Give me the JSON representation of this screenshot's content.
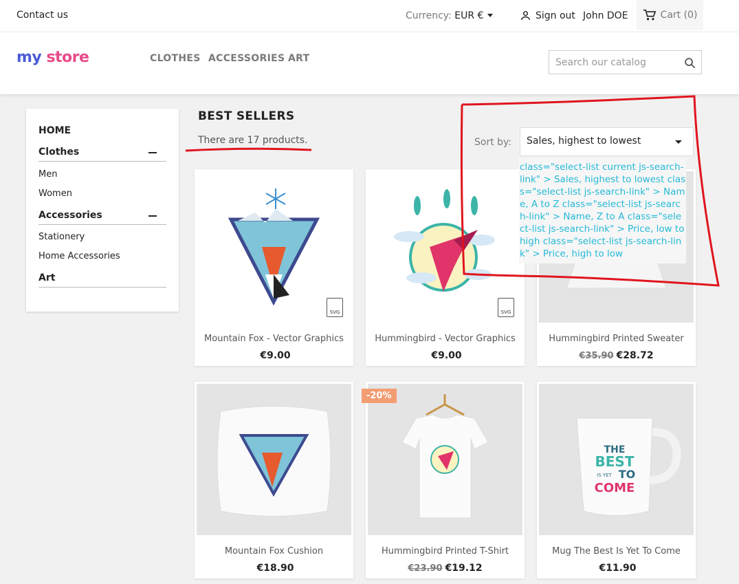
{
  "topbar": {
    "contact": "Contact us",
    "currency_label": "Currency:",
    "currency_value": "EUR €",
    "signout": "Sign out",
    "username": "John DOE",
    "cart": "Cart (0)"
  },
  "header": {
    "logo_part1": "my",
    "logo_part2": "store",
    "nav": [
      "CLOTHES",
      "ACCESSORIES",
      "ART"
    ],
    "search_placeholder": "Search our catalog"
  },
  "sidebar": {
    "home": "HOME",
    "categories": [
      {
        "label": "Clothes",
        "children": [
          "Men",
          "Women"
        ]
      },
      {
        "label": "Accessories",
        "children": [
          "Stationery",
          "Home Accessories"
        ]
      },
      {
        "label": "Art",
        "children": []
      }
    ]
  },
  "main": {
    "title": "BEST SELLERS",
    "count": "There are 17 products.",
    "sort_label": "Sort by:",
    "sort_value": "Sales, highest to lowest",
    "dropdown_text": "class=\"select-list current js-search-link\" > Sales, highest to lowest class=\"select-list js-search-link\" > Name, A to Z class=\"select-list js-search-link\" > Name, Z to A class=\"select-list js-search-link\" > Price, low to high class=\"select-list js-search-link\" > Price, high to low"
  },
  "products": [
    {
      "name": "Mountain Fox - Vector Graphics",
      "price": "€9.00",
      "old_price": ""
    },
    {
      "name": "Hummingbird - Vector Graphics",
      "price": "€9.00",
      "old_price": ""
    },
    {
      "name": "Hummingbird Printed Sweater",
      "price": "€28.72",
      "old_price": "€35.90"
    },
    {
      "name": "Mountain Fox Cushion",
      "price": "€18.90",
      "old_price": ""
    },
    {
      "name": "Hummingbird Printed T-Shirt",
      "price": "€19.12",
      "old_price": "€23.90",
      "badge": "-20%"
    },
    {
      "name": "Mug The Best Is Yet To Come",
      "price": "€11.90",
      "old_price": ""
    }
  ],
  "svg_tag": "SVG",
  "mug_text": [
    "THE",
    "BEST",
    "IS YET",
    "TO",
    "COME"
  ],
  "colors": {
    "accent": "#24b9d7",
    "annotation_red": "#e0141e",
    "badge": "#f39d72"
  }
}
